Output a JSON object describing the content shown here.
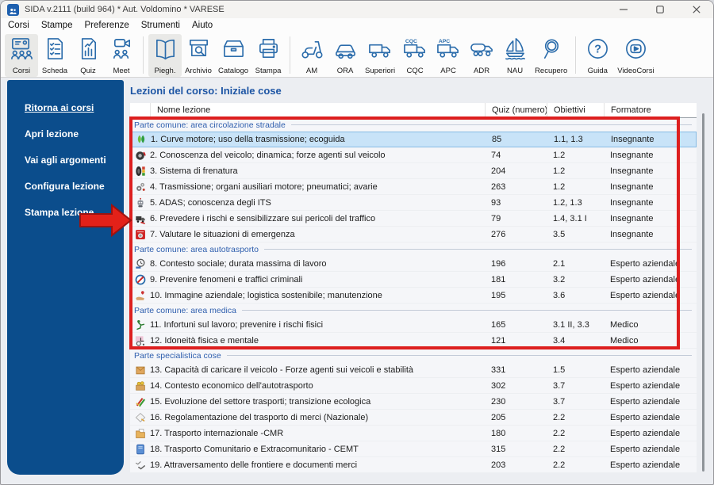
{
  "window": {
    "title": "SIDA v.2111 (build 964) * Aut. Voldomino * VARESE"
  },
  "menu": [
    "Corsi",
    "Stampe",
    "Preferenze",
    "Strumenti",
    "Aiuto"
  ],
  "toolbar": {
    "groups": [
      {
        "items": [
          {
            "label": "Corsi",
            "icon": "classroom-icon",
            "active": true
          },
          {
            "label": "Scheda",
            "icon": "checklist-doc-icon",
            "active": false
          },
          {
            "label": "Quiz",
            "icon": "quiz-doc-icon",
            "active": false
          },
          {
            "label": "Meet",
            "icon": "video-meeting-icon",
            "active": false
          }
        ]
      },
      {
        "items": [
          {
            "label": "Piegh.",
            "icon": "open-book-icon",
            "active": true
          },
          {
            "label": "Archivio",
            "icon": "archive-search-icon",
            "active": false
          },
          {
            "label": "Catalogo",
            "icon": "catalog-drawer-icon",
            "active": false
          },
          {
            "label": "Stampa",
            "icon": "printer-icon",
            "active": false
          }
        ]
      },
      {
        "items": [
          {
            "label": "AM",
            "icon": "scooter-icon",
            "active": false
          },
          {
            "label": "ORA",
            "icon": "car-icon",
            "active": false
          },
          {
            "label": "Superiori",
            "icon": "truck-icon",
            "active": false
          },
          {
            "label": "CQC",
            "icon": "truck-cqc-icon",
            "active": false
          },
          {
            "label": "APC",
            "icon": "truck-apc-icon",
            "active": false
          },
          {
            "label": "ADR",
            "icon": "tanker-truck-icon",
            "active": false
          },
          {
            "label": "NAU",
            "icon": "sailboat-icon",
            "active": false
          },
          {
            "label": "Recupero",
            "icon": "magnifier-icon",
            "active": false
          }
        ]
      },
      {
        "items": [
          {
            "label": "Guida",
            "icon": "help-circle-icon",
            "active": false
          },
          {
            "label": "VideoCorsi",
            "icon": "video-play-circle-icon",
            "active": false
          }
        ]
      }
    ]
  },
  "sidebar": {
    "items": [
      "Ritorna ai corsi",
      "Apri lezione",
      "Vai agli argomenti",
      "Configura lezione",
      "Stampa lezione"
    ]
  },
  "main": {
    "title": "Lezioni del corso: Iniziale cose",
    "columns": [
      "Nome lezione",
      "Quiz (numero)",
      "Obiettivi",
      "Formatore"
    ],
    "sections": [
      {
        "label": "Parte comune: area circolazione stradale",
        "rows": [
          {
            "icon": "eco-leaves-icon",
            "name": "1. Curve motore; uso della trasmissione; ecoguida",
            "quiz": "85",
            "obiettivi": "1.1, 1.3",
            "formatore": "Insegnante",
            "selected": true
          },
          {
            "icon": "wheel-dynamics-icon",
            "name": "2. Conoscenza del veicolo; dinamica; forze agenti sul veicolo",
            "quiz": "74",
            "obiettivi": "1.2",
            "formatore": "Insegnante",
            "selected": false
          },
          {
            "icon": "tire-traffic-light-icon",
            "name": "3. Sistema di frenatura",
            "quiz": "204",
            "obiettivi": "1.2",
            "formatore": "Insegnante",
            "selected": false
          },
          {
            "icon": "gears-icon",
            "name": "4. Trasmissione; organi ausiliari motore; pneumatici; avarie",
            "quiz": "263",
            "obiettivi": "1.2",
            "formatore": "Insegnante",
            "selected": false
          },
          {
            "icon": "adas-robot-icon",
            "name": "5. ADAS; conoscenza degli ITS",
            "quiz": "93",
            "obiettivi": "1.2, 1.3",
            "formatore": "Insegnante",
            "selected": false
          },
          {
            "icon": "truck-hazard-icon",
            "name": "6. Prevedere i rischi e sensibilizzare sui pericoli del traffico",
            "quiz": "79",
            "obiettivi": "1.4, 3.1 I",
            "formatore": "Insegnante",
            "selected": false
          },
          {
            "icon": "emergency-alarm-icon",
            "name": "7. Valutare le situazioni di emergenza",
            "quiz": "276",
            "obiettivi": "3.5",
            "formatore": "Insegnante",
            "selected": false
          }
        ]
      },
      {
        "label": "Parte comune: area autotrasporto",
        "rows": [
          {
            "icon": "work-clock-icon",
            "name": "8. Contesto sociale; durata massima di lavoro",
            "quiz": "196",
            "obiettivi": "2.1",
            "formatore": "Esperto aziendale",
            "selected": false
          },
          {
            "icon": "no-entry-icon",
            "name": "9. Prevenire fenomeni e traffici criminali",
            "quiz": "181",
            "obiettivi": "3.2",
            "formatore": "Esperto aziendale",
            "selected": false
          },
          {
            "icon": "hand-heart-icon",
            "name": "10. Immagine aziendale; logistica sostenibile; manutenzione",
            "quiz": "195",
            "obiettivi": "3.6",
            "formatore": "Esperto aziendale",
            "selected": false
          }
        ]
      },
      {
        "label": "Parte comune: area medica",
        "rows": [
          {
            "icon": "physical-training-icon",
            "name": "11. Infortuni sul lavoro; prevenire i rischi fisici",
            "quiz": "165",
            "obiettivi": "3.1 II, 3.3",
            "formatore": "Medico",
            "selected": false
          },
          {
            "icon": "wheelchair-icon",
            "name": "12. Idoneità fisica e mentale",
            "quiz": "121",
            "obiettivi": "3.4",
            "formatore": "Medico",
            "selected": false
          }
        ]
      },
      {
        "label": "Parte specialistica cose",
        "rows": [
          {
            "icon": "cargo-box-icon",
            "name": "13. Capacità di caricare il veicolo - Forze agenti sui veicoli e stabilità",
            "quiz": "331",
            "obiettivi": "1.5",
            "formatore": "Esperto aziendale",
            "selected": false
          },
          {
            "icon": "money-box-icon",
            "name": "14. Contesto economico dell'autotrasporto",
            "quiz": "302",
            "obiettivi": "3.7",
            "formatore": "Esperto aziendale",
            "selected": false
          },
          {
            "icon": "eco-pencils-icon",
            "name": "15. Evoluzione del settore trasporti; transizione ecologica",
            "quiz": "230",
            "obiettivi": "3.7",
            "formatore": "Esperto aziendale",
            "selected": false
          },
          {
            "icon": "freight-envelope-icon",
            "name": "16. Regolamentazione del trasporto di merci (Nazionale)",
            "quiz": "205",
            "obiettivi": "2.2",
            "formatore": "Esperto aziendale",
            "selected": false
          },
          {
            "icon": "international-folder-icon",
            "name": "17. Trasporto internazionale -CMR",
            "quiz": "180",
            "obiettivi": "2.2",
            "formatore": "Esperto aziendale",
            "selected": false
          },
          {
            "icon": "blue-book-icon",
            "name": "18. Trasporto Comunitario e Extracomunitario - CEMT",
            "quiz": "315",
            "obiettivi": "2.2",
            "formatore": "Esperto aziendale",
            "selected": false
          },
          {
            "icon": "border-birds-icon",
            "name": "19. Attraversamento delle frontiere e documenti merci",
            "quiz": "203",
            "obiettivi": "2.2",
            "formatore": "Esperto aziendale",
            "selected": false
          }
        ]
      }
    ]
  },
  "colors": {
    "accent_blue": "#0b4d8c",
    "icon_blue": "#2b6cab",
    "annotation_red": "#dd1f1f",
    "selected_row": "#c8e3f8"
  }
}
